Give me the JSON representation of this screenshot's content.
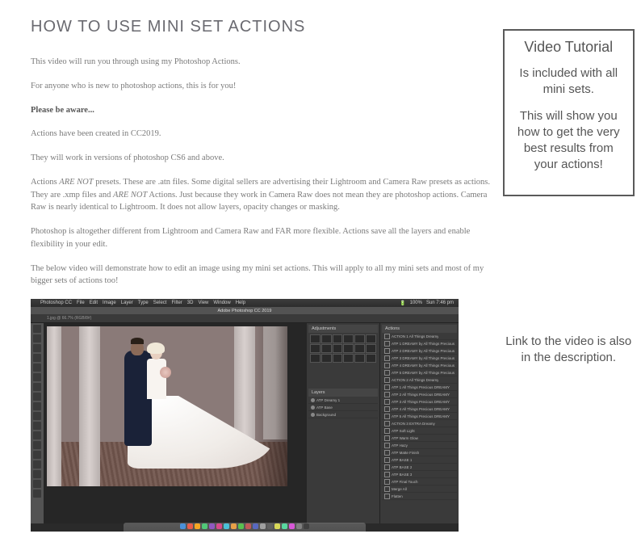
{
  "title": "HOW TO USE MINI SET ACTIONS",
  "paragraphs": {
    "p1": "This video will run you through using my Photoshop Actions.",
    "p2": "For anyone who is new to photoshop actions, this is for you!",
    "p3": "Please be aware...",
    "p4": "Actions have been created in CC2019.",
    "p5": "They will work in versions of photoshop CS6 and above.",
    "p6a": "Actions ",
    "p6b": "ARE NOT",
    "p6c": " presets. These are .atn files.  Some digital sellers are advertising their Lightroom and Camera Raw presets as actions. They are .xmp files and ",
    "p6d": "ARE NOT",
    "p6e": " Actions.  Just because they work in Camera Raw does not mean they are photoshop actions. Camera Raw is nearly identical to Lightroom. It does not allow layers, opacity changes or masking.",
    "p7": "Photoshop is altogether different from Lightroom and Camera Raw and FAR more flexible.  Actions save all the layers and enable flexibility in your edit.",
    "p8": "The below video will demonstrate how to edit an image using my mini set actions.  This will apply to all my mini sets and most of my bigger sets of actions too!"
  },
  "callout": {
    "title": "Video Tutorial",
    "p1": "Is included with all mini sets.",
    "p2": "This will show you how to get the very best results from your actions!"
  },
  "link_note": "Link to the video is also in the description.",
  "photoshop": {
    "mac_menu": [
      "Photoshop CC",
      "File",
      "Edit",
      "Image",
      "Layer",
      "Type",
      "Select",
      "Filter",
      "3D",
      "View",
      "Window",
      "Help"
    ],
    "mac_right": [
      "100%",
      "Sun 7:46 pm"
    ],
    "window_title": "Adobe Photoshop CC 2019",
    "tab": "1.jpg @ 66.7% (RGB/8#)",
    "panels": {
      "adjustments": "Adjustments",
      "layers": "Layers",
      "actions": "Actions"
    },
    "layer_items": [
      "ATP Dreamy 1",
      "ATP Base",
      "Background"
    ],
    "action_items": [
      "ACTION 1 All Things Dreamy",
      "ATP 1 DREAMY by All Things Precious",
      "ATP 2 DREAMY by All Things Precious",
      "ATP 3 DREAMY by All Things Precious",
      "ATP 4 DREAMY by All Things Precious",
      "ATP 5 DREAMY by All Things Precious",
      "ACTION 2 All Things Dreamy",
      "ATP 1 All Things Precious DREAMY",
      "ATP 2 All Things Precious DREAMY",
      "ATP 3 All Things Precious DREAMY",
      "ATP 4 All Things Precious DREAMY",
      "ATP 5 All Things Precious DREAMY",
      "ACTION 3 EXTRA Dreamy",
      "ATP Soft Light",
      "ATP Warm Glow",
      "ATP Hazy",
      "ATP Matte Finish",
      "ATP BASE 1",
      "ATP BASE 2",
      "ATP BASE 3",
      "ATP Final Touch",
      "Merge All",
      "Flatten"
    ],
    "dock_colors": [
      "#4a90d9",
      "#e85c4a",
      "#f5a623",
      "#50c878",
      "#9058c0",
      "#d84a8a",
      "#4ac0d8",
      "#e8a048",
      "#58c050",
      "#c05858",
      "#5868c0",
      "#a0a0a0",
      "#606060",
      "#d8d858",
      "#58d8a0",
      "#d858d8",
      "#808080",
      "#404040"
    ]
  }
}
